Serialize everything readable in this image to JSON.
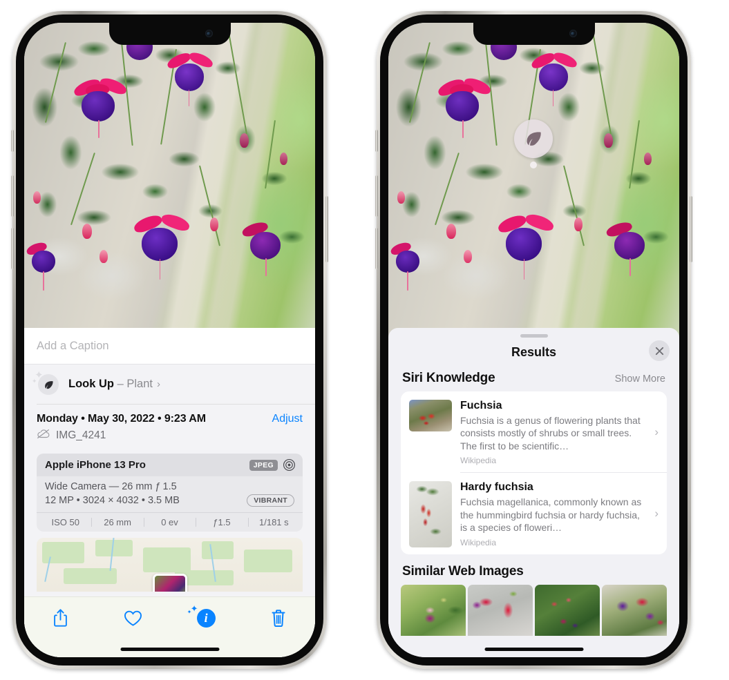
{
  "left_phone": {
    "photo": {
      "alt": "fuchsia-flowers-photo"
    },
    "caption_placeholder": "Add a Caption",
    "caption_value": "",
    "lookup": {
      "icon": "leaf-icon",
      "label": "Look Up",
      "dash": " – ",
      "subject": "Plant",
      "chevron": "›"
    },
    "meta": {
      "date": "Monday • May 30, 2022 • 9:23 AM",
      "adjust_label": "Adjust",
      "cloud_icon": "icloud-slash-icon",
      "filename": "IMG_4241"
    },
    "exif": {
      "model": "Apple iPhone 13 Pro",
      "format_badge": "JPEG",
      "aperture_icon": "aperture-icon",
      "lens_line": "Wide Camera — 26 mm ƒ 1.5",
      "size_line": "12 MP • 3024 × 4032 • 3.5 MB",
      "style_badge": "VIBRANT",
      "stats": [
        "ISO 50",
        "26 mm",
        "0 ev",
        "ƒ1.5",
        "1/181 s"
      ]
    },
    "map": {
      "name": "location-map-thumbnail"
    },
    "toolbar": [
      {
        "name": "share-button",
        "icon": "share-icon"
      },
      {
        "name": "favorite-button",
        "icon": "heart-icon"
      },
      {
        "name": "info-button",
        "icon": "sparkle-info-icon",
        "glyph": "i"
      },
      {
        "name": "delete-button",
        "icon": "trash-icon"
      }
    ]
  },
  "right_phone": {
    "photo": {
      "alt": "fuchsia-flowers-photo"
    },
    "visual_lookup_badge": {
      "icon": "leaf-icon"
    },
    "sheet": {
      "grabber": "drag-handle",
      "title": "Results",
      "close_icon": "close-icon"
    },
    "siri_knowledge": {
      "title": "Siri Knowledge",
      "show_more": "Show More",
      "items": [
        {
          "title": "Fuchsia",
          "description": "Fuchsia is a genus of flowering plants that consists mostly of shrubs or small trees. The first to be scientific…",
          "source": "Wikipedia",
          "thumb": "fuchsia-red-flowers-thumb",
          "chevron": "›"
        },
        {
          "title": "Hardy fuchsia",
          "description": "Fuchsia magellanica, commonly known as the hummingbird fuchsia or hardy fuchsia, is a species of floweri…",
          "source": "Wikipedia",
          "thumb": "hardy-fuchsia-branch-thumb",
          "chevron": "›"
        }
      ]
    },
    "similar_web_images": {
      "title": "Similar Web Images",
      "items": [
        {
          "name": "similar-image-1"
        },
        {
          "name": "similar-image-2"
        },
        {
          "name": "similar-image-3"
        },
        {
          "name": "similar-image-4"
        }
      ]
    }
  },
  "colors": {
    "accent_blue": "#0a84ff",
    "sheet_gray": "#f1f1f5",
    "card_white": "#ffffff",
    "secondary_text": "#8a8a8e"
  }
}
